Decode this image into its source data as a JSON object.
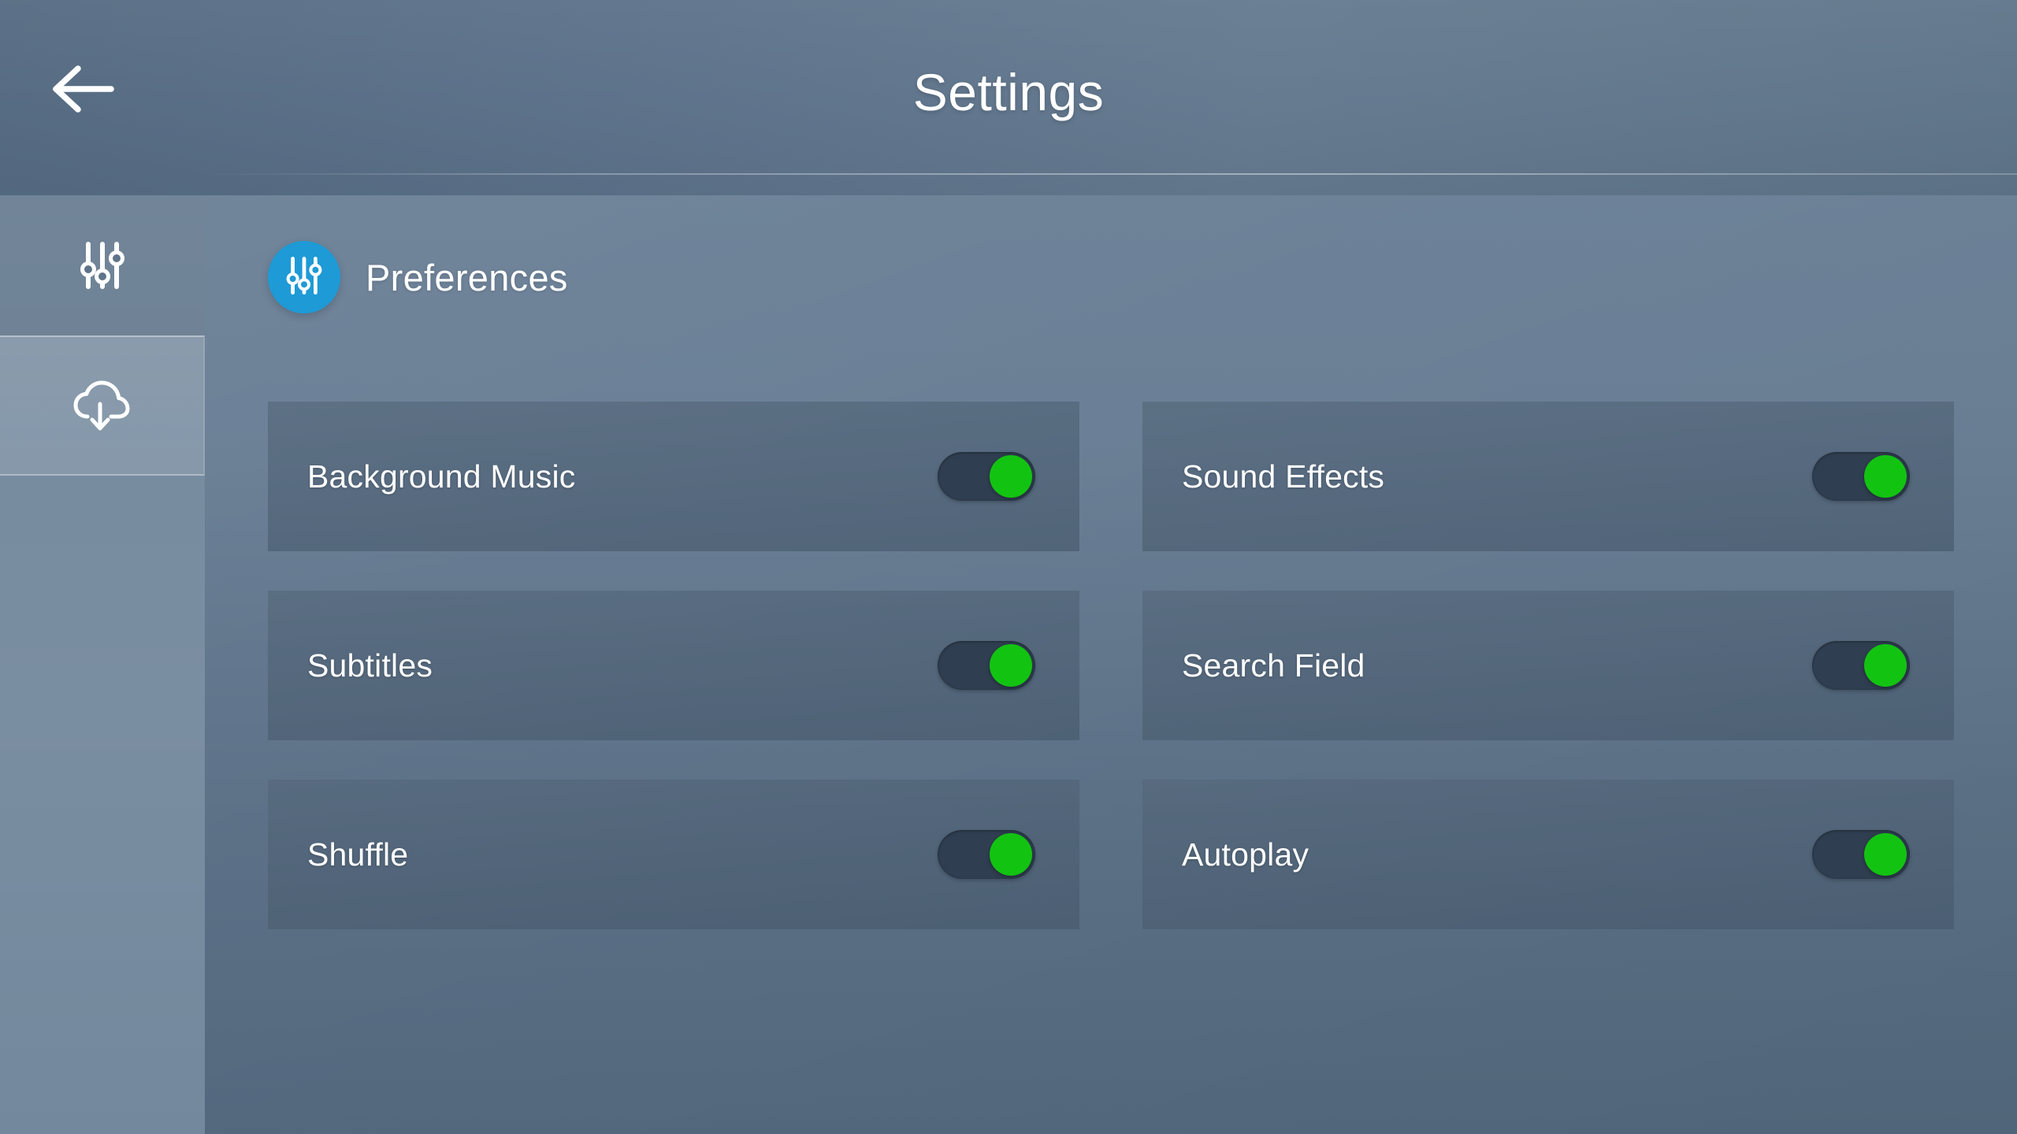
{
  "header": {
    "title": "Settings",
    "back_icon": "arrow-left-icon"
  },
  "colors": {
    "accent_blue": "#1e9ad6",
    "toggle_on_knob": "#13c312",
    "toggle_track": "#2f3e50",
    "page_background": "#6b8096",
    "card_background": "#4a5d72",
    "text": "#ffffff"
  },
  "sidebar": {
    "items": [
      {
        "name": "preferences",
        "icon": "sliders-icon",
        "active": false
      },
      {
        "name": "downloads",
        "icon": "cloud-download-icon",
        "active": true
      }
    ]
  },
  "main": {
    "section": {
      "title": "Preferences",
      "icon": "sliders-icon"
    },
    "settings": [
      {
        "label": "Background Music",
        "state": "on"
      },
      {
        "label": "Sound Effects",
        "state": "on"
      },
      {
        "label": "Subtitles",
        "state": "on"
      },
      {
        "label": "Search Field",
        "state": "on"
      },
      {
        "label": "Shuffle",
        "state": "on"
      },
      {
        "label": "Autoplay",
        "state": "on"
      }
    ]
  }
}
